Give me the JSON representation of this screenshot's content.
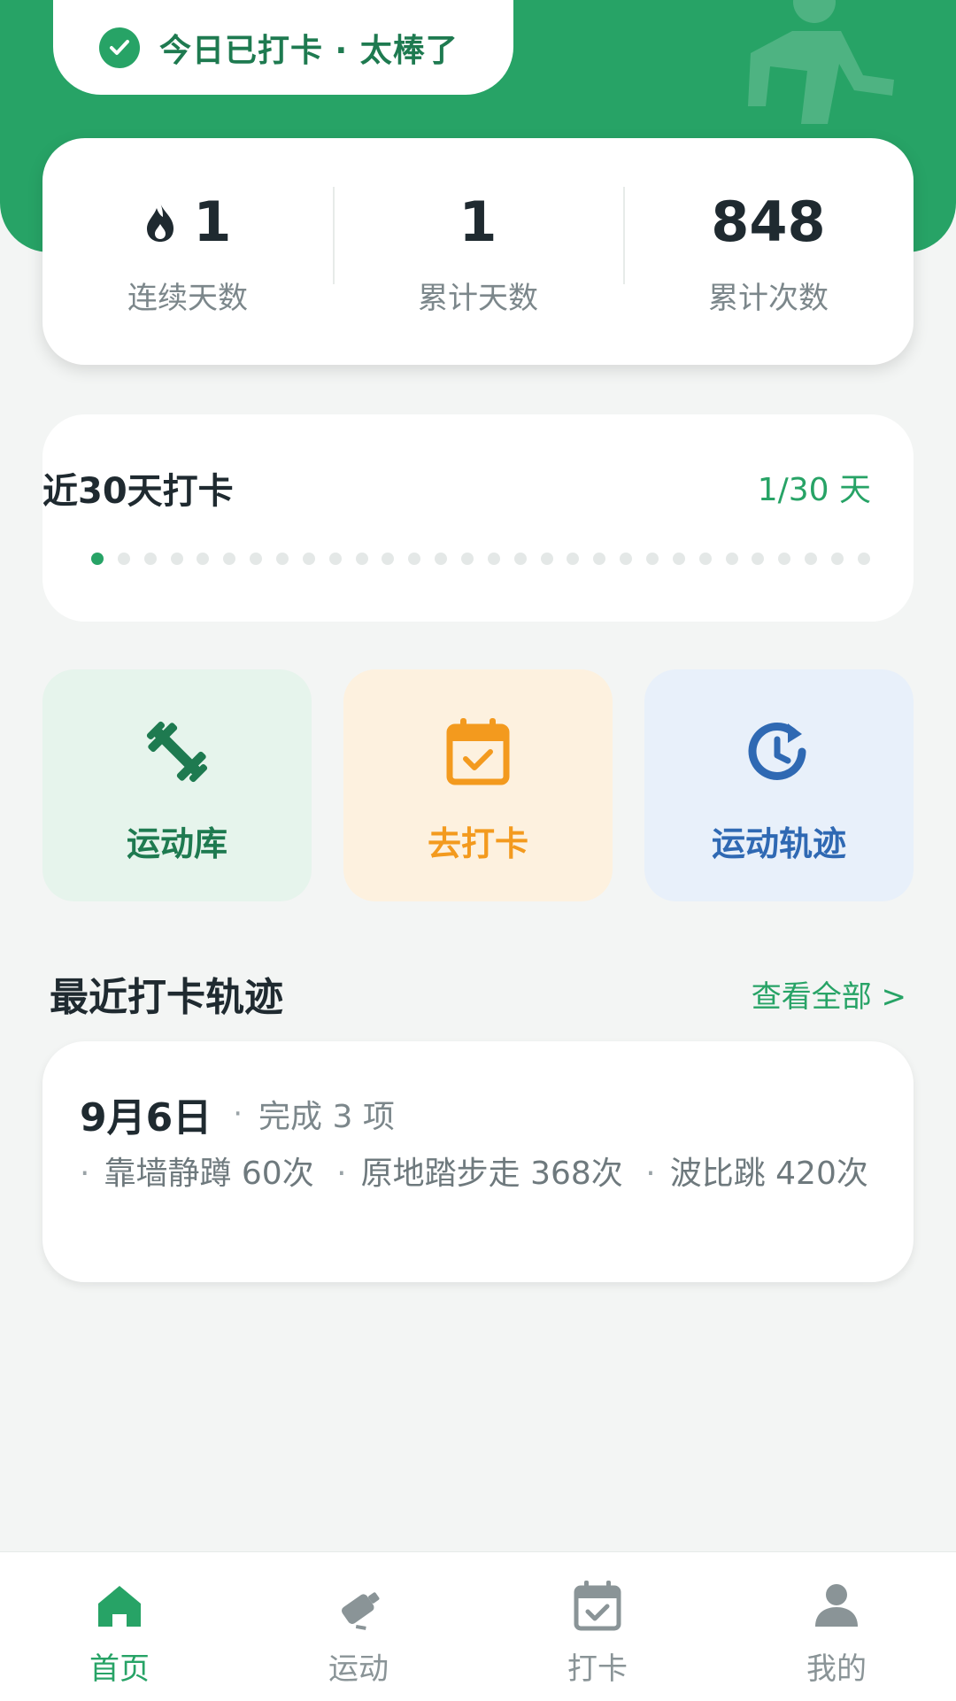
{
  "header": {
    "status_text": "今日已打卡 · 太棒了",
    "accent_color": "#27a366",
    "status_icon": "check-circle-icon",
    "figure_icon": "walking-person-icon"
  },
  "stats": [
    {
      "value": "1",
      "label": "连续天数",
      "icon": "flame-icon"
    },
    {
      "value": "1",
      "label": "累计天数"
    },
    {
      "value": "848",
      "label": "累计次数"
    }
  ],
  "streak": {
    "title": "近30天打卡",
    "count": "1/30 天",
    "days_checked": 1,
    "days_total": 30
  },
  "tiles": [
    {
      "label": "运动库",
      "icon": "dumbbell-icon",
      "color": "#1e7a50",
      "bg": "#e6f4ec"
    },
    {
      "label": "去打卡",
      "icon": "calendar-check-icon",
      "color": "#f39a1e",
      "bg": "#fdf1df"
    },
    {
      "label": "运动轨迹",
      "icon": "history-clock-icon",
      "color": "#2f69b3",
      "bg": "#e8f0fa"
    }
  ],
  "recent": {
    "section_title": "最近打卡轨迹",
    "view_all": "查看全部 >",
    "entry": {
      "date": "9月6日",
      "sep": "·",
      "done": "完成 3 项",
      "items": [
        "靠墙静蹲 60次",
        "原地踏步走 368次",
        "波比跳 420次"
      ]
    }
  },
  "tabbar": [
    {
      "label": "首页",
      "icon": "home-icon",
      "active": true
    },
    {
      "label": "运动",
      "icon": "sport-icon",
      "active": false
    },
    {
      "label": "打卡",
      "icon": "calendar-check-icon",
      "active": false
    },
    {
      "label": "我的",
      "icon": "user-icon",
      "active": false
    }
  ]
}
